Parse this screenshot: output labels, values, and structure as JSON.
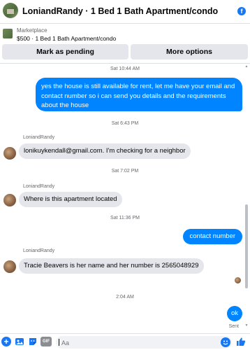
{
  "header": {
    "title": "LoniandRandy · 1 Bed 1 Bath Apartment/condo",
    "brand_color": "#1877f2"
  },
  "listing": {
    "source": "Marketplace",
    "details": "$500 · 1 Bed 1 Bath Apartment/condo"
  },
  "actions": {
    "mark_pending": "Mark as pending",
    "more_options": "More options"
  },
  "messages": {
    "ts1": "Sat 10:44 AM",
    "out1": "yes the house is still available for rent, let me have your email  and contact number so i can send you details and the requirements about the house",
    "ts2": "Sat 6:43 PM",
    "sender1": "LoniandRandy",
    "in1": "lonikuykendall@gmail.com.  I'm checking for a neighbor",
    "ts3": "Sat 7:02 PM",
    "sender2": "LoniandRandy",
    "in2": "Where is this apartment located",
    "ts4": "Sat 11:36 PM",
    "out2": "contact number",
    "sender3": "LoniandRandy",
    "in3": "Tracie Beavers is her name and her number is 2565048929",
    "ts5": "2:04 AM",
    "out3": "ok",
    "status": "Sent"
  },
  "composer": {
    "placeholder": "Aa",
    "gif_label": "GIF"
  },
  "colors": {
    "outgoing_bubble": "#0084ff",
    "incoming_bubble": "#e4e6eb"
  }
}
